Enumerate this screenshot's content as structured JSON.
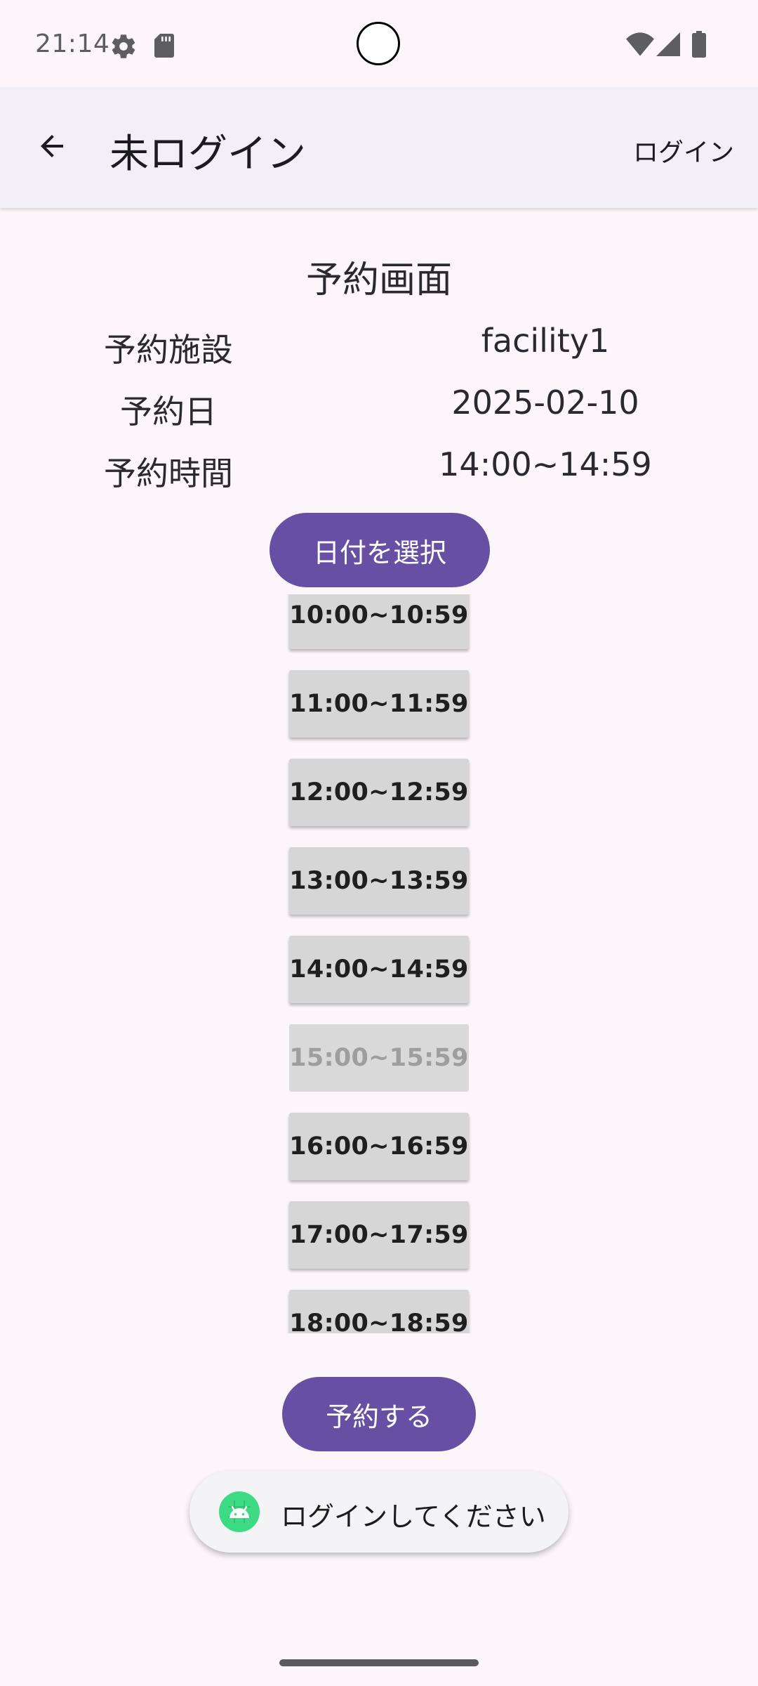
{
  "status_bar": {
    "time": "21:14",
    "icons": [
      "settings-gear-icon",
      "sd-card-icon",
      "wifi-icon",
      "cell-signal-icon",
      "battery-icon"
    ]
  },
  "app_bar": {
    "back_icon": "arrow-left-icon",
    "title": "未ログイン",
    "login_label": "ログイン"
  },
  "content": {
    "title": "予約画面",
    "info": [
      {
        "label": "予約施設",
        "value": "facility1"
      },
      {
        "label": "予約日",
        "value": "2025-02-10"
      },
      {
        "label": "予約時間",
        "value": "14:00~14:59"
      }
    ],
    "select_date_label": "日付を選択",
    "time_slots": [
      {
        "label": "10:00~10:59",
        "enabled": true
      },
      {
        "label": "11:00~11:59",
        "enabled": true
      },
      {
        "label": "12:00~12:59",
        "enabled": true
      },
      {
        "label": "13:00~13:59",
        "enabled": true
      },
      {
        "label": "14:00~14:59",
        "enabled": true
      },
      {
        "label": "15:00~15:59",
        "enabled": false
      },
      {
        "label": "16:00~16:59",
        "enabled": true
      },
      {
        "label": "17:00~17:59",
        "enabled": true
      },
      {
        "label": "18:00~18:59",
        "enabled": true
      }
    ],
    "reserve_label": "予約する"
  },
  "toast": {
    "icon": "android-icon",
    "message": "ログインしてください"
  },
  "colors": {
    "primary": "#6750A4",
    "background": "#FCF6FB",
    "app_bar": "#F2EFF6",
    "slot_bg": "#D6D6D6"
  }
}
